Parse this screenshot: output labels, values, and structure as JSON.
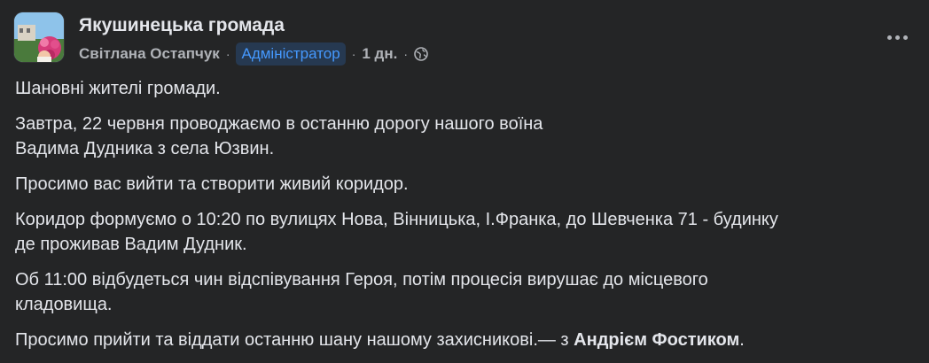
{
  "post": {
    "group_name": "Якушинецька громада",
    "author": "Світлана Остапчук",
    "role_badge": "Адміністратор",
    "time": "1 дн.",
    "separator": "·",
    "paragraphs": [
      "Шановні жителі громади.",
      "Завтра, 22 червня проводжаємо в останню дорогу нашого воїна\nВадима Дудника з села Юзвин.",
      "Просимо вас вийти та створити живий коридор.",
      "Коридор формуємо о 10:20 по вулицях Нова,  Вінницька, І.Франка, до Шевченка 71 - будинку\nде проживав Вадим Дудник.",
      "Об 11:00  відбудеться чин відспівування Героя, потім процесія вирушає до місцевого\nкладовища."
    ],
    "last_paragraph": "Просимо прийти та віддати останню шану нашому захисникові.",
    "tag_prefix": "— з",
    "tagged_person": "Андрієм Фостиком",
    "tag_suffix": "."
  },
  "icons": {
    "globe": "globe-icon",
    "more": "more-options-icon"
  },
  "colors": {
    "background": "#242526",
    "primary_text": "#e4e6eb",
    "secondary_text": "#b0b3b8",
    "badge_bg": "#263951",
    "badge_text": "#4599ff"
  }
}
